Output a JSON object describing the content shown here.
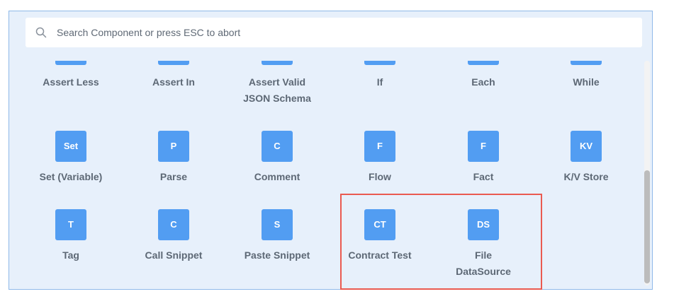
{
  "search": {
    "placeholder": "Search Component or press ESC to abort"
  },
  "rows": [
    [
      {
        "label_lines": [
          "Assert Less"
        ]
      },
      {
        "label_lines": [
          "Assert In"
        ]
      },
      {
        "label_lines": [
          "Assert Valid",
          "JSON Schema"
        ]
      },
      {
        "label_lines": [
          "If"
        ]
      },
      {
        "label_lines": [
          "Each"
        ]
      },
      {
        "label_lines": [
          "While"
        ]
      }
    ],
    [
      {
        "abbr": "Set",
        "label_lines": [
          "Set (Variable)"
        ]
      },
      {
        "abbr": "P",
        "label_lines": [
          "Parse"
        ]
      },
      {
        "abbr": "C",
        "label_lines": [
          "Comment"
        ]
      },
      {
        "abbr": "F",
        "label_lines": [
          "Flow"
        ]
      },
      {
        "abbr": "F",
        "label_lines": [
          "Fact"
        ]
      },
      {
        "abbr": "KV",
        "label_lines": [
          "K/V Store"
        ]
      }
    ],
    [
      {
        "abbr": "T",
        "label_lines": [
          "Tag"
        ]
      },
      {
        "abbr": "C",
        "label_lines": [
          "Call Snippet"
        ]
      },
      {
        "abbr": "S",
        "label_lines": [
          "Paste Snippet"
        ]
      },
      {
        "abbr": "CT",
        "label_lines": [
          "Contract Test"
        ]
      },
      {
        "abbr": "DS",
        "label_lines": [
          "File",
          "DataSource"
        ]
      }
    ]
  ],
  "colors": {
    "tile": "#529df2",
    "panel_bg": "#e7f0fb",
    "panel_border": "#8fb9e9",
    "label": "#5d6875",
    "highlight": "#ea5a50"
  }
}
